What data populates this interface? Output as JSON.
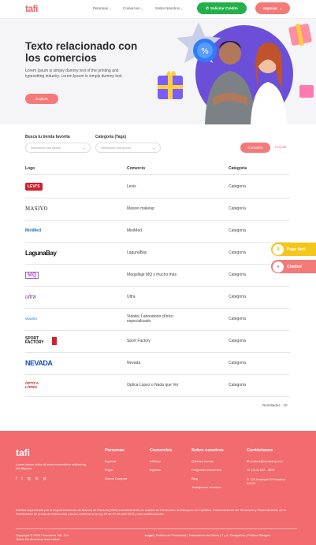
{
  "header": {
    "logo": "tafi",
    "nav": [
      {
        "label": "Personas"
      },
      {
        "label": "Comercios"
      },
      {
        "label": "Sobre Nosotros"
      }
    ],
    "cta_credit": "Solicitar Crédito",
    "cta_login": "Ingresar"
  },
  "hero": {
    "title": "Texto relacionado con los comercios",
    "description": "Lorem Ipsum is simply dummy text of the printing and typesetting industry. Lorem Ipsum is simply dummy text.",
    "button": "Explora"
  },
  "filters": {
    "store_label": "Busca tu tienda favorita",
    "store_placeholder": "Seleccione una opción",
    "category_label": "Categoría (Tags)",
    "category_placeholder": "Seleccione una opción",
    "consult": "Consultar",
    "clear": "Limpiar"
  },
  "table": {
    "headers": {
      "logo": "Logo",
      "store": "Comercio",
      "category": "Categoría"
    },
    "rows": [
      {
        "logo": "LEVI'S",
        "name": "Levis",
        "category": "Categoría"
      },
      {
        "logo": "MASIVO",
        "name": "Masivo makeup",
        "category": "Categoría"
      },
      {
        "logo": "MiniMed",
        "name": "MiniMed",
        "category": "Categoría"
      },
      {
        "logo": "LagunaBay",
        "name": "LagunaBay",
        "category": "Categoría"
      },
      {
        "logo": "MQ",
        "name": "Maquillaje MQ y mucho más",
        "category": "Categoría"
      },
      {
        "logo": "ultra",
        "name": "Ultra",
        "category": "Categoría"
      },
      {
        "logo": "VIDATEC",
        "name": "Vidatec Laboratorio clínico especializado",
        "category": "Categoría"
      },
      {
        "logo": "SPORT FACTORY",
        "name": "Sport Factory",
        "category": "Categoría"
      },
      {
        "logo": "NEVADA",
        "name": "Nevada",
        "category": "Categoría"
      },
      {
        "logo": "ÓPTICA LÓPEZ",
        "name": "Optica Lopez o Nada que Ver",
        "category": "Categoría"
      }
    ],
    "results": "Resultados - 10"
  },
  "floating": {
    "pay": "Pago fácil",
    "chat": "Chatbot"
  },
  "footer": {
    "logo": "tafi",
    "description": "Lorem ipsum dolor sit amet consectetur adipiscing elit aliquam.",
    "social": [
      "f",
      "t",
      "ig",
      "in",
      "yt"
    ],
    "columns": [
      {
        "title": "Personas",
        "links": [
          "Ingresar",
          "Pagar",
          "Dónde Comprar"
        ]
      },
      {
        "title": "Comercios",
        "links": [
          "Afiliarse",
          "Ingresar"
        ]
      },
      {
        "title": "Sobre nosotros",
        "links": [
          "Quiénes somos",
          "Preguntas frecuentes",
          "Blog",
          "Trabaja con nosotros"
        ]
      }
    ],
    "contact_title": "Contáctanos",
    "contact_email": "contact@company.com",
    "contact_phone": "(414) 687 - 5892",
    "contact_address": "123 Example St Panamá 94123",
    "legal": "Entidad supervisada por la Superintendencia de Bancos de Panamá (SBP) exclusivamente en materia de Prevención de Blanqueo de Capitales, Financiamiento del Terrorismo y Financiamiento de la Proliferación de armas de destrucción masiva conforme a la Ley 23 de 27 de abril 2015 y sus modificaciones.",
    "copyright": "Copyright © 2024 Financiera Tafi, S.A.",
    "rights": "Todos los derechos reservados.",
    "legal_link": "Legal",
    "legal_links": "| Política de Privacidad | Tratamiento de Datos | T y C Campañas | Política Riesgos"
  },
  "colors": {
    "brand": "#f0656b",
    "accent": "#f47a7a",
    "green": "#23b04b",
    "yellow": "#f5c518"
  }
}
